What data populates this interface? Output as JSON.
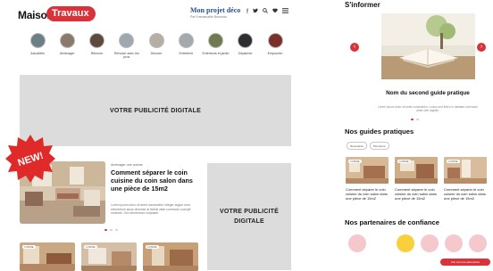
{
  "header": {
    "logo_maison": "Maison",
    "logo_travaux": "Travaux",
    "project_title": "Mon projet déco",
    "project_subtitle": "Par Emmanuelle Bonneau",
    "social_icons": [
      "facebook-icon",
      "twitter-icon",
      "search-icon",
      "heart-icon",
      "menu-icon"
    ]
  },
  "categories": [
    {
      "label": "Actualités",
      "color": "#6b7f86"
    },
    {
      "label": "Aménager",
      "color": "#8a7a6c"
    },
    {
      "label": "Rénover",
      "color": "#5c4a3c"
    },
    {
      "label": "Rénover avec les pros",
      "color": "#9fa8b0"
    },
    {
      "label": "Décorer",
      "color": "#b7aea3"
    },
    {
      "label": "Entretenir",
      "color": "#a3a9ad"
    },
    {
      "label": "Extérieurs et jardin",
      "color": "#6f7a4f"
    },
    {
      "label": "Dépanner",
      "color": "#2f2d32"
    },
    {
      "label": "Emprunter",
      "color": "#7a2f2a"
    }
  ],
  "ads": {
    "big": "VOTRE PUBLICITÉ DIGITALE",
    "small": "VOTRE PUBLICITÉ DIGITALE"
  },
  "badge": "NEW!",
  "featured": {
    "category": "Aménager une cuisine",
    "title": "Comment séparer le coin cuisine du coin salon dans une pièce de 15m2",
    "description": "Lorem ipsum dolor sit amet consectetur integer augue urna elementum lacus dictumst at facilisi vitae commodo suscipit molestie. Orci elementum vulputate."
  },
  "bottom_tags": [
    "CUISINE",
    "CUISINE",
    "CUISINE"
  ],
  "sidebar": {
    "title": "S'informer",
    "guide_title": "Nom du second guide pratique",
    "guide_description": "Lorem ipsum dolor sit amet consectetur. Lectus sed libero in habitant commodo amet nibh sagittis.",
    "prev_label": "‹",
    "next_label": "›",
    "guides_title": "Nos guides pratiques",
    "pills": [
      "Rénovation",
      "Plomberie"
    ],
    "guide_cards": [
      {
        "tag": "CUISINE",
        "text": "Comment séparer le coin cuisine du coin salon dans une pièce de 15m2"
      },
      {
        "tag": "CUISINE",
        "text": "Comment séparer le coin cuisine du coin salon dans une pièce de 15m2"
      },
      {
        "tag": "CUISINE",
        "text": "Comment séparer le coin cuisine du coin salon dans une pièce de 15m2"
      }
    ],
    "partners_title": "Nos partenaires de confiance",
    "partner_colors": [
      "#f4c8cd",
      "#f9cf3c",
      "#f4c8cd",
      "#f4c8cd",
      "#f4c8cd"
    ],
    "cta": "Voir tous les partenaires"
  },
  "colors": {
    "accent": "#d8333a",
    "brand_blue": "#2b4d91",
    "ad_grey": "#dcdcdc"
  }
}
